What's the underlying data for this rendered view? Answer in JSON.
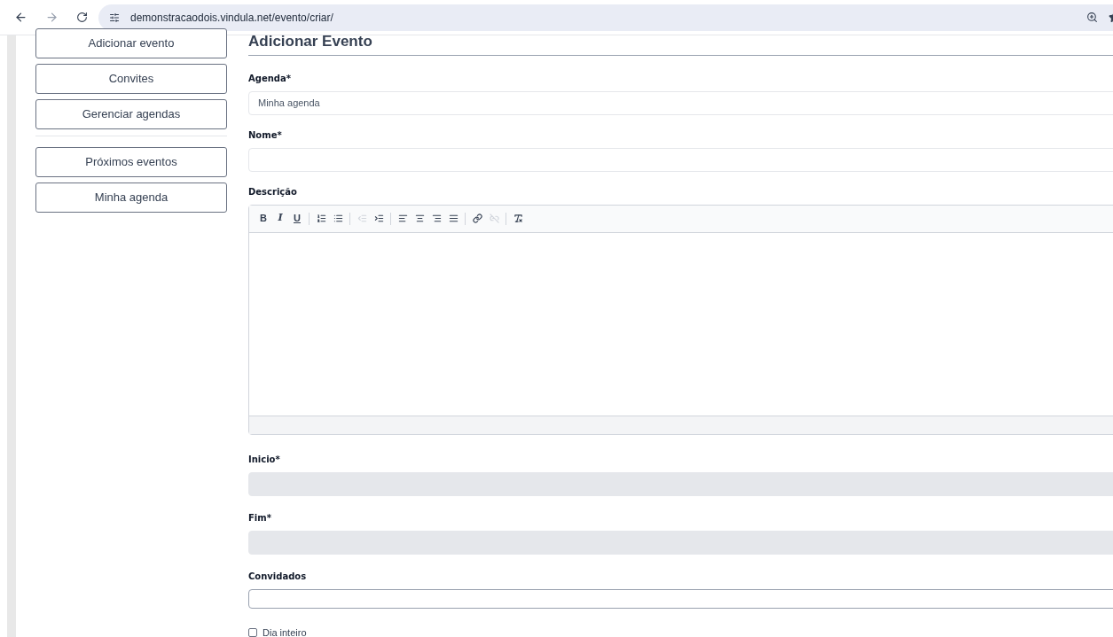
{
  "browser": {
    "url": "demonstracaodois.vindula.net/evento/criar/"
  },
  "sidebar": {
    "groups": [
      {
        "items": [
          {
            "label": "Adicionar evento"
          },
          {
            "label": "Convites"
          },
          {
            "label": "Gerenciar agendas"
          }
        ]
      },
      {
        "items": [
          {
            "label": "Próximos eventos"
          },
          {
            "label": "Minha agenda"
          }
        ]
      }
    ]
  },
  "form": {
    "title": "Adicionar Evento",
    "fields": [
      {
        "kind": "select",
        "label": "Agenda*",
        "value": "Minha agenda",
        "disabled": false
      },
      {
        "kind": "text",
        "label": "Nome*",
        "disabled": false
      },
      {
        "kind": "editor",
        "label": "Descrição",
        "toolbar": [
          {
            "kind": "bold",
            "label": "B",
            "disabled": false
          },
          {
            "kind": "italic",
            "label": "I",
            "disabled": false
          },
          {
            "kind": "underline",
            "label": "U",
            "disabled": false
          },
          {
            "kind": "separator"
          },
          {
            "kind": "numbered",
            "disabled": false
          },
          {
            "kind": "bulleted",
            "disabled": false
          },
          {
            "kind": "separator"
          },
          {
            "kind": "outdent",
            "disabled": true
          },
          {
            "kind": "indent",
            "disabled": false
          },
          {
            "kind": "separator"
          },
          {
            "kind": "left",
            "disabled": false
          },
          {
            "kind": "center",
            "disabled": false
          },
          {
            "kind": "right",
            "disabled": false
          },
          {
            "kind": "justify",
            "disabled": false
          },
          {
            "kind": "separator"
          },
          {
            "kind": "link",
            "disabled": false
          },
          {
            "kind": "unlink",
            "disabled": true
          },
          {
            "kind": "separator"
          },
          {
            "kind": "clear",
            "disabled": false
          }
        ]
      },
      {
        "kind": "text",
        "label": "Inicio*",
        "disabled": true
      },
      {
        "kind": "text",
        "label": "Fim*",
        "disabled": true
      },
      {
        "kind": "text",
        "label": "Convidados",
        "disabled": false
      },
      {
        "kind": "checkbox",
        "label": "Dia inteiro",
        "checked": false
      }
    ]
  }
}
